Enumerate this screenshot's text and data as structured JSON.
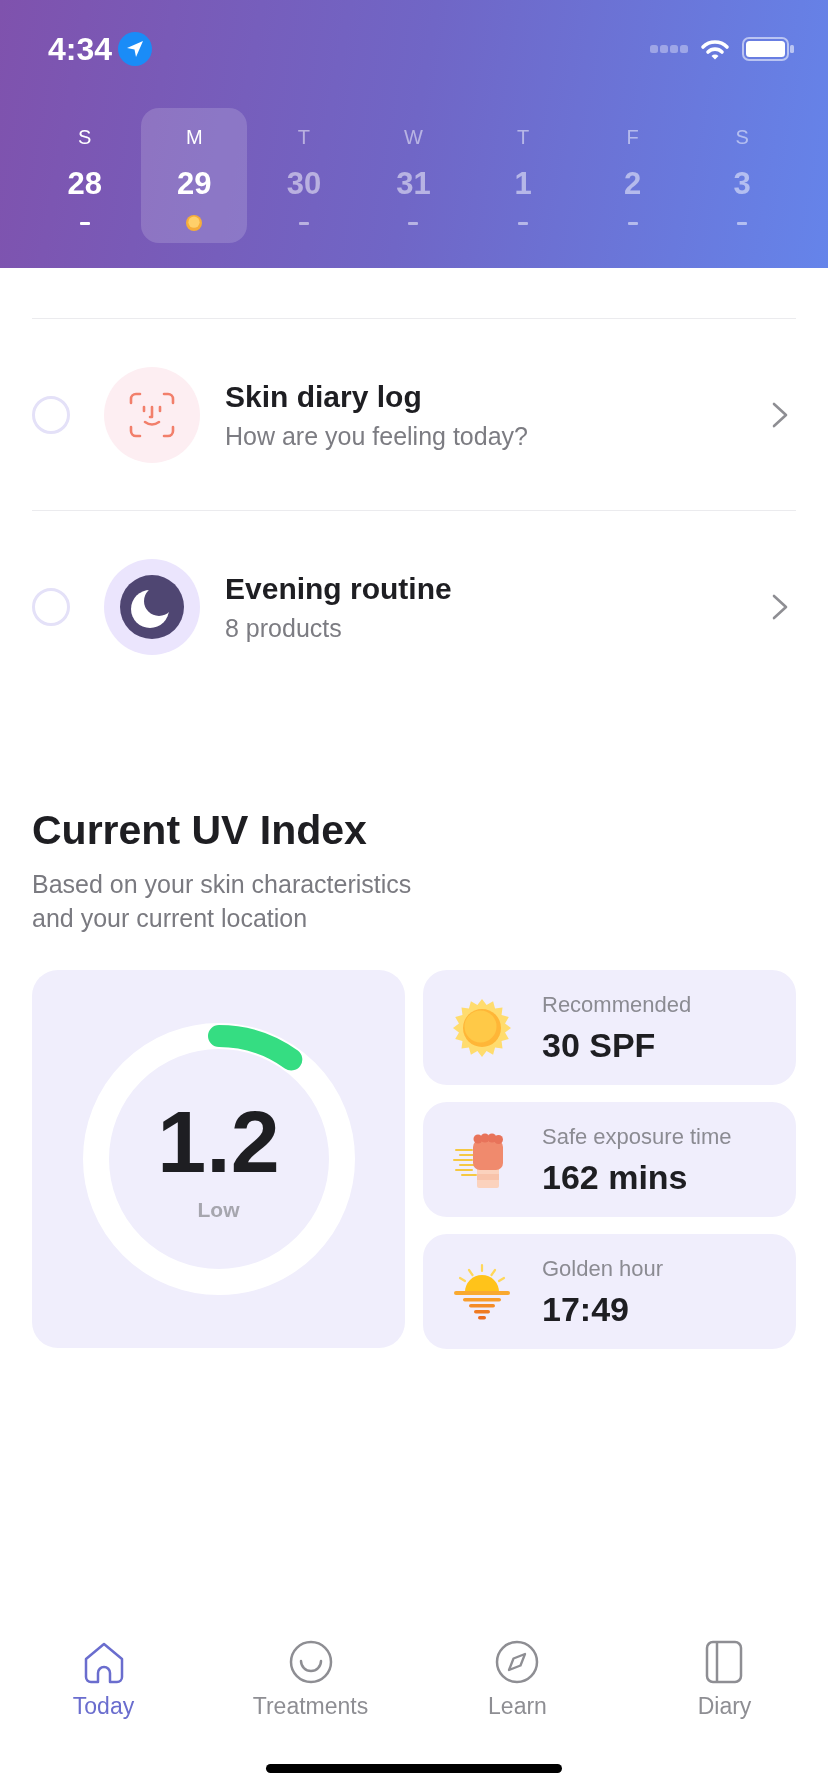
{
  "status_bar": {
    "time": "4:34"
  },
  "week": [
    {
      "weekday": "S",
      "date": "28",
      "selected": false,
      "disabled": false,
      "logged": false
    },
    {
      "weekday": "M",
      "date": "29",
      "selected": true,
      "disabled": false,
      "logged": true
    },
    {
      "weekday": "T",
      "date": "30",
      "selected": false,
      "disabled": true,
      "logged": false
    },
    {
      "weekday": "W",
      "date": "31",
      "selected": false,
      "disabled": true,
      "logged": false
    },
    {
      "weekday": "T",
      "date": "1",
      "selected": false,
      "disabled": true,
      "logged": false
    },
    {
      "weekday": "F",
      "date": "2",
      "selected": false,
      "disabled": true,
      "logged": false
    },
    {
      "weekday": "S",
      "date": "3",
      "selected": false,
      "disabled": true,
      "logged": false
    }
  ],
  "tasks": [
    {
      "kind": "diary",
      "title": "Skin diary log",
      "subtitle": "How are you feeling today?",
      "checked": false
    },
    {
      "kind": "routine",
      "title": "Evening routine",
      "subtitle": "8 products",
      "checked": false
    }
  ],
  "uv": {
    "title": "Current UV Index",
    "subtitle": "Based on your skin characteristics and your current location",
    "gauge": {
      "value": "1.2",
      "label": "Low",
      "level": 0.1
    },
    "stats": [
      {
        "kind": "spf",
        "label": "Recommended",
        "value": "30 SPF"
      },
      {
        "kind": "exposure",
        "label": "Safe exposure time",
        "value": "162 mins"
      },
      {
        "kind": "sunset",
        "label": "Golden hour",
        "value": "17:49"
      }
    ]
  },
  "tabs": [
    {
      "kind": "home",
      "label": "Today",
      "selected": true
    },
    {
      "kind": "face",
      "label": "Treatments",
      "selected": false
    },
    {
      "kind": "compass",
      "label": "Learn",
      "selected": false
    },
    {
      "kind": "book",
      "label": "Diary",
      "selected": false
    }
  ]
}
